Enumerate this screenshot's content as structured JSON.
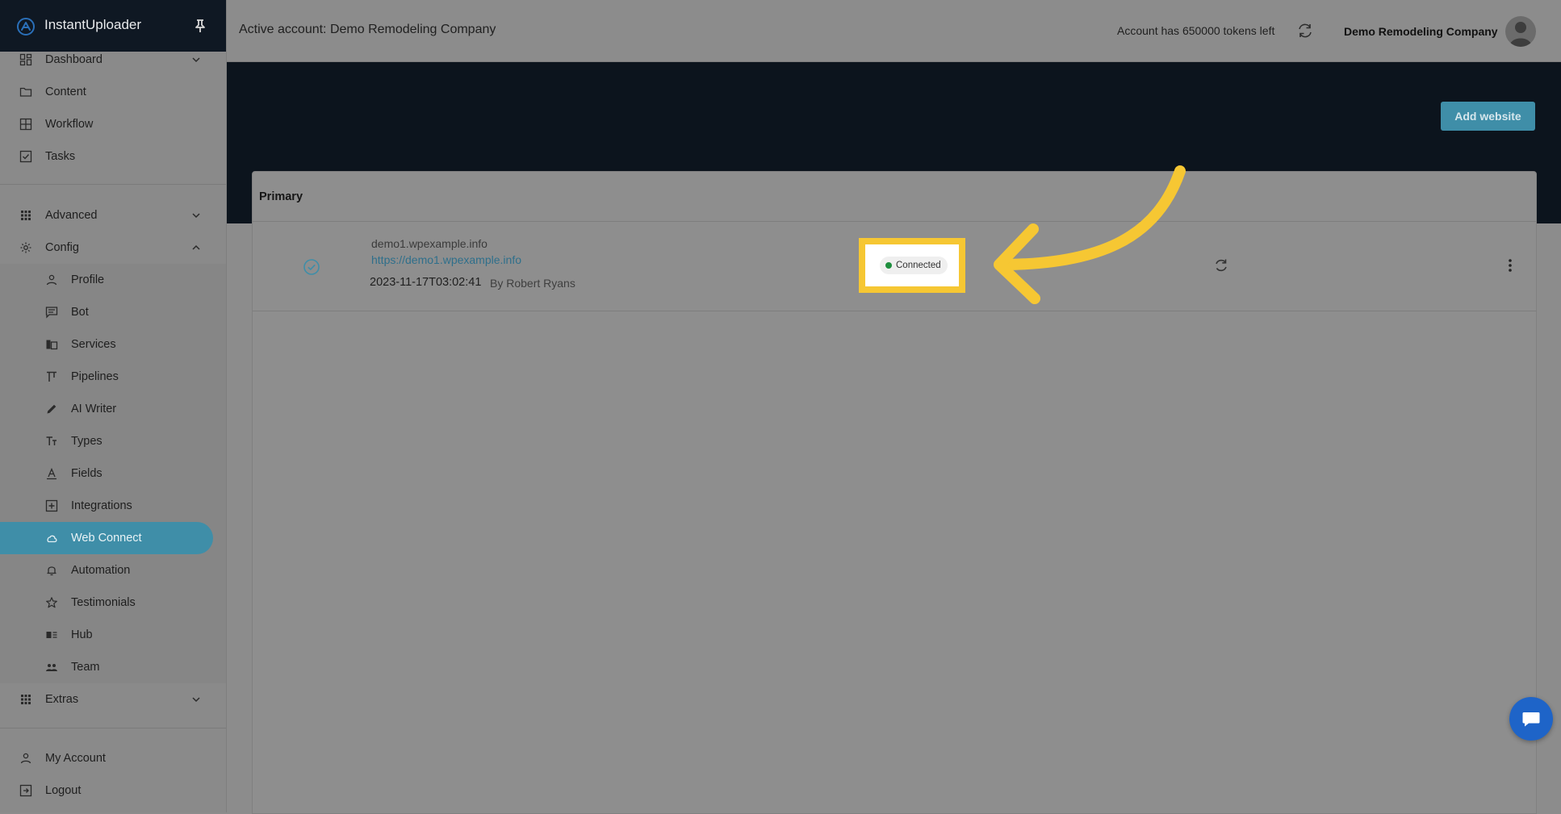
{
  "app": {
    "name": "InstantUploader"
  },
  "sidebar": {
    "top_items": [
      {
        "label": "Dashboard",
        "icon": "dashboard-icon"
      },
      {
        "label": "Content",
        "icon": "folder-icon"
      },
      {
        "label": "Workflow",
        "icon": "grid-icon"
      },
      {
        "label": "Tasks",
        "icon": "checkbox-icon"
      }
    ],
    "advanced_label": "Advanced",
    "config_label": "Config",
    "config_items": [
      {
        "label": "Profile",
        "icon": "user-icon"
      },
      {
        "label": "Bot",
        "icon": "chat-icon"
      },
      {
        "label": "Services",
        "icon": "services-icon"
      },
      {
        "label": "Pipelines",
        "icon": "pipeline-icon"
      },
      {
        "label": "AI Writer",
        "icon": "pencil-icon"
      },
      {
        "label": "Types",
        "icon": "text-type-icon"
      },
      {
        "label": "Fields",
        "icon": "fields-icon"
      },
      {
        "label": "Integrations",
        "icon": "plus-square-icon"
      },
      {
        "label": "Web Connect",
        "icon": "cloud-icon",
        "active": true
      },
      {
        "label": "Automation",
        "icon": "bell-icon"
      },
      {
        "label": "Testimonials",
        "icon": "star-icon"
      },
      {
        "label": "Hub",
        "icon": "hub-icon"
      },
      {
        "label": "Team",
        "icon": "team-icon"
      }
    ],
    "extras_label": "Extras",
    "bottom_items": [
      {
        "label": "My Account",
        "icon": "user-icon"
      },
      {
        "label": "Logout",
        "icon": "logout-icon"
      }
    ]
  },
  "header": {
    "active_account": "Active account: Demo Remodeling Company",
    "tokens": "Account has 650000 tokens left",
    "company": "Demo Remodeling Company"
  },
  "main": {
    "add_website_label": "Add website",
    "card_title": "Primary",
    "site": {
      "name": "demo1.wpexample.info",
      "url": "https://demo1.wpexample.info",
      "date": "2023-11-17T03:02:41",
      "by": "By Robert Ryans",
      "status": "Connected"
    }
  },
  "colors": {
    "accent": "#3f8ea8",
    "highlight": "#f6c733",
    "status_connected": "#1e8e3e",
    "brand_bg": "#0f1823"
  }
}
